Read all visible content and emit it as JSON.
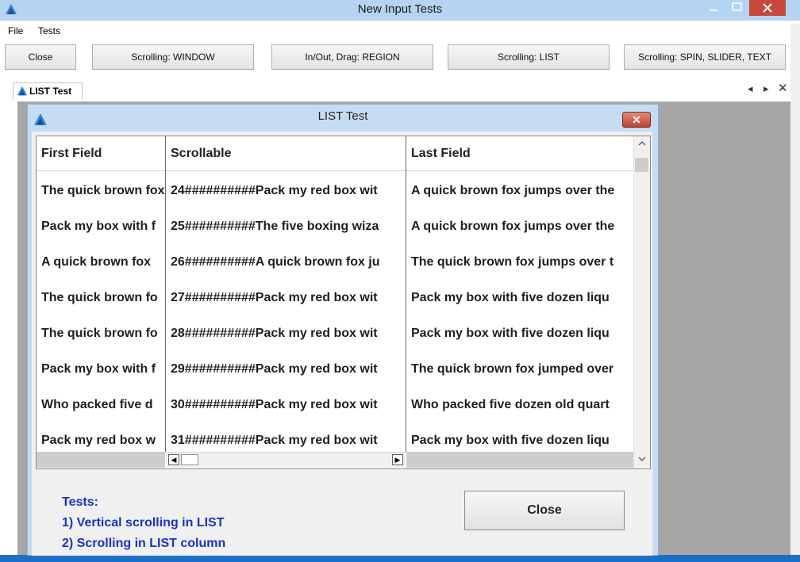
{
  "window": {
    "title": "New Input Tests"
  },
  "menu": [
    "File",
    "Tests"
  ],
  "toolbar": {
    "buttons": [
      "Close",
      "Scrolling: WINDOW",
      "In/Out, Drag: REGION",
      "Scrolling: LIST",
      "Scrolling: SPIN, SLIDER, TEXT"
    ]
  },
  "tab": {
    "label": "LIST Test",
    "nav_left": "◂",
    "nav_right": "▸",
    "close": "✕"
  },
  "dialog": {
    "title": "LIST Test",
    "close_glyph": "✕"
  },
  "list": {
    "columns": [
      "First Field",
      "Scrollable",
      "Last Field"
    ],
    "rows": [
      [
        "The quick brown fox",
        "24##########Pack my red box wit",
        "A quick brown fox jumps over the"
      ],
      [
        "Pack my box with f",
        "25##########The five boxing wiza",
        "A quick brown fox jumps over the"
      ],
      [
        "A quick brown fox",
        "26##########A quick brown fox ju",
        "The quick brown fox jumps over t"
      ],
      [
        "The quick brown fo",
        "27##########Pack my red box wit",
        "Pack my box with five dozen liqu"
      ],
      [
        "The quick brown fo",
        "28##########Pack my red box wit",
        "Pack my box with five dozen liqu"
      ],
      [
        "Pack my box with f",
        "29##########Pack my red box wit",
        "The quick brown fox jumped over"
      ],
      [
        "Who packed five d",
        "30##########Pack my red box wit",
        "Who packed five dozen old quart"
      ],
      [
        "Pack my red box w",
        "31##########Pack my red box wit",
        "Pack my box with five dozen liqu"
      ]
    ]
  },
  "tests": {
    "title": "Tests:",
    "items": [
      "1) Vertical scrolling in LIST",
      "2) Scrolling in LIST column"
    ]
  },
  "close_button": "Close",
  "colors": {
    "title_bar": "#b5d3f2",
    "accent_blue": "#1c2fcf",
    "close_red": "#c9483c"
  },
  "icons": [
    "app-logo-icon",
    "minimize-icon",
    "maximize-icon",
    "close-icon",
    "arrow-left-icon",
    "arrow-right-icon",
    "arrow-up-icon",
    "arrow-down-icon"
  ]
}
